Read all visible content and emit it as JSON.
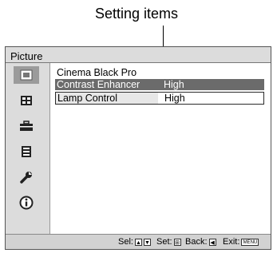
{
  "annotation": {
    "label": "Setting items"
  },
  "menu": {
    "title": "Picture",
    "sidebar_icons": [
      {
        "name": "picture-icon",
        "active": true
      },
      {
        "name": "screen-icon",
        "active": false
      },
      {
        "name": "setup-icon",
        "active": false
      },
      {
        "name": "menu-settings-icon",
        "active": false
      },
      {
        "name": "wrench-icon",
        "active": false
      },
      {
        "name": "information-icon",
        "active": false
      }
    ],
    "items": [
      {
        "label": "Cinema Black Pro",
        "value": ""
      },
      {
        "label": "Contrast Enhancer",
        "value": "High",
        "selected": true
      },
      {
        "label": "Lamp Control",
        "value": "High",
        "focused": true
      }
    ]
  },
  "statusbar": {
    "select_label": "Sel:",
    "set_label": "Set:",
    "back_label": "Back:",
    "exit_label": "Exit:",
    "menu_key_label": "MENU"
  },
  "colors": {
    "menu_bg": "#dcdcdc",
    "selected_row_bg": "#6b6b6b",
    "active_icon_bg": "#9b9b9b"
  }
}
